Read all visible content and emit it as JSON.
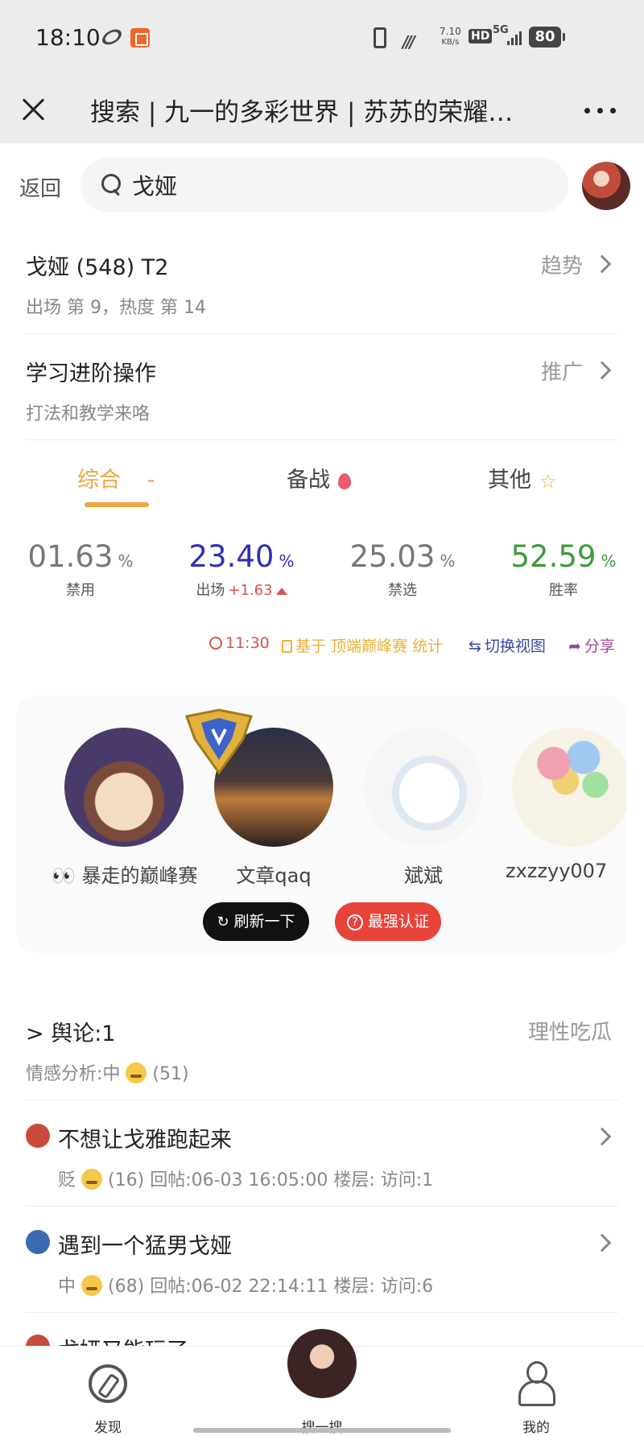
{
  "status_bar": {
    "time": "18:10",
    "net_speed_top": "7.10",
    "net_speed_unit": "KB/s",
    "hd": "HD",
    "network": "5G",
    "battery": "80"
  },
  "title_bar": {
    "title": "搜索 | 九一的多彩世界 | 苏苏的荣耀…"
  },
  "search": {
    "back_label": "返回",
    "query": "戈娅"
  },
  "hero": {
    "title": "戈娅 (548) T2",
    "trend_label": "趋势",
    "subtitle": "出场 第 9，热度 第 14"
  },
  "learn": {
    "title": "学习进阶操作",
    "promo_label": "推广",
    "subtitle": "打法和教学来咯"
  },
  "tabs": [
    {
      "label": "综合",
      "suffix": "-"
    },
    {
      "label": "备战"
    },
    {
      "label": "其他"
    }
  ],
  "stats": [
    {
      "value": "01.63",
      "unit": "%",
      "label": "禁用",
      "color": "#777777"
    },
    {
      "value": "23.40",
      "unit": "%",
      "label": "出场",
      "delta": "+1.63",
      "color": "#2e2eb8"
    },
    {
      "value": "25.03",
      "unit": "%",
      "label": "禁选",
      "color": "#777777"
    },
    {
      "value": "52.59",
      "unit": "%",
      "label": "胜率",
      "color": "#3c9a3c"
    }
  ],
  "meta": {
    "time": "11:30",
    "source": "基于 顶端巅峰赛 统计",
    "switch_view": "切换视图",
    "share": "分享"
  },
  "players": [
    {
      "name": "👀 暴走的巅峰赛"
    },
    {
      "name": "文章qaq"
    },
    {
      "name": "斌斌"
    },
    {
      "name": "zxzzyy007"
    }
  ],
  "player_actions": {
    "refresh": "刷新一下",
    "certify": "最强认证"
  },
  "opinion": {
    "title": "> 舆论:1",
    "tag": "理性吃瓜",
    "sentiment": "情感分析:中",
    "sentiment_count": "(51)"
  },
  "posts": [
    {
      "title": "不想让戈雅跑起来",
      "mood": "贬",
      "count": "(16)",
      "meta": "回帖:06-03 16:05:00 楼层: 访问:1"
    },
    {
      "title": "遇到一个猛男戈娅",
      "mood": "中",
      "count": "(68)",
      "meta": "回帖:06-02 22:14:11 楼层: 访问:6"
    },
    {
      "title": "戈娅又能玩了"
    }
  ],
  "bottom_nav": [
    {
      "label": "发现"
    },
    {
      "label": "搜一搜"
    },
    {
      "label": "我的"
    }
  ]
}
